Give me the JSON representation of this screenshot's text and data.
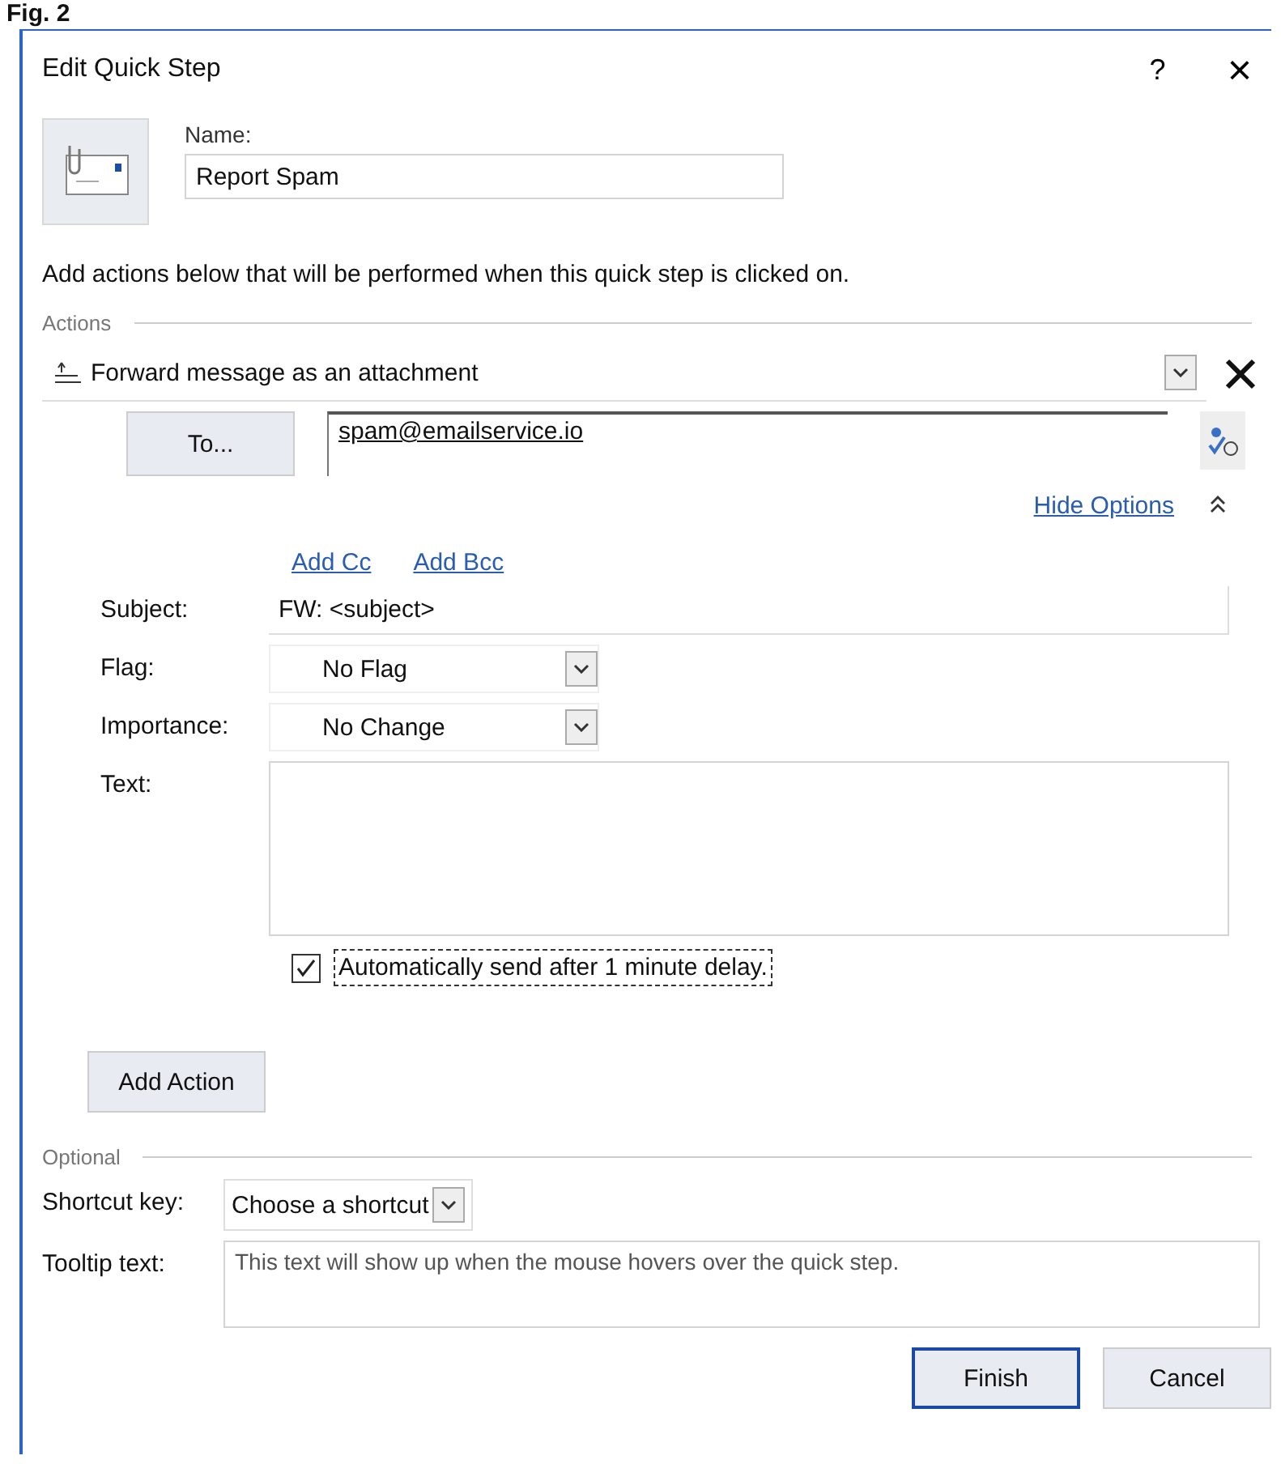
{
  "figure_label": "Fig. 2",
  "window": {
    "title": "Edit Quick Step",
    "help": "?",
    "close": "×"
  },
  "name": {
    "label": "Name:",
    "value": "Report Spam"
  },
  "instructions": "Add actions below that will be performed when this quick step is clicked on.",
  "actions_group": "Actions",
  "action": {
    "value": "Forward message as an attachment",
    "to_button": "To...",
    "to_value": "spam@emailservice.io",
    "hide_options": "Hide Options",
    "add_cc": "Add Cc",
    "add_bcc": "Add Bcc",
    "fields": [
      {
        "kind": "text",
        "label": "Subject:",
        "value": "FW: <subject>"
      },
      {
        "kind": "dropdown",
        "label": "Flag:",
        "value": "No Flag"
      },
      {
        "kind": "dropdown",
        "label": "Importance:",
        "value": "No Change"
      },
      {
        "kind": "area",
        "label": "Text:"
      }
    ],
    "auto_send": {
      "label": "Automatically send after 1 minute delay.",
      "checked": true
    }
  },
  "add_action": "Add Action",
  "optional_group": "Optional",
  "shortcut": {
    "label": "Shortcut key:",
    "value": "Choose a shortcut"
  },
  "tooltip": {
    "label": "Tooltip text:",
    "placeholder": "This text will show up when the mouse hovers over the quick step."
  },
  "buttons": [
    {
      "label": "Finish",
      "default": true
    },
    {
      "label": "Cancel",
      "default": false
    }
  ]
}
